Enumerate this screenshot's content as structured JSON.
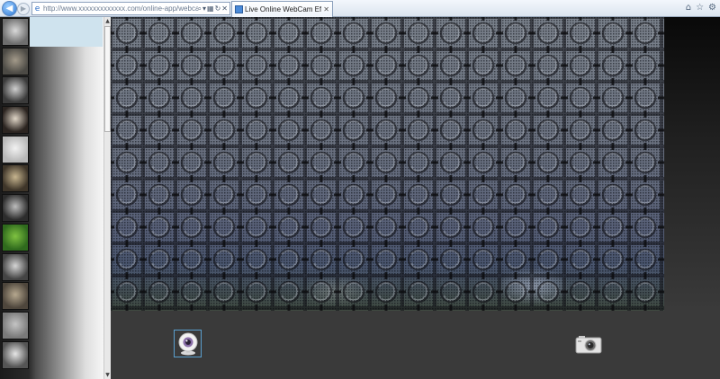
{
  "browser": {
    "url": "http://www.xxxxxxxxxxxxx.com/online-app/webcam-ef",
    "tab_title": "Live Online WebCam Eff...",
    "icons": [
      "back-icon",
      "forward-icon",
      "search-icon",
      "refresh-icon",
      "stop-icon",
      "home-icon",
      "favorites-icon",
      "tools-icon"
    ]
  },
  "sidebar": {
    "thumbnails": [
      {
        "name": "koala",
        "colors": [
          "#d9d9d9",
          "#6e6e6e"
        ]
      },
      {
        "name": "koala-texture",
        "colors": [
          "#a39a8a",
          "#4c4a45"
        ]
      },
      {
        "name": "spiral",
        "colors": [
          "#cfcfcf",
          "#3b3b3b"
        ]
      },
      {
        "name": "stripes",
        "colors": [
          "#e0d6c7",
          "#2b2420"
        ]
      },
      {
        "name": "white-blur",
        "colors": [
          "#f2f2f2",
          "#b8b8b8"
        ]
      },
      {
        "name": "koala-color",
        "colors": [
          "#c7b58f",
          "#3e3529"
        ]
      },
      {
        "name": "koala-dark",
        "colors": [
          "#bdbdbd",
          "#2c2c2c"
        ]
      },
      {
        "name": "green",
        "colors": [
          "#7fc241",
          "#2f6a1d"
        ]
      },
      {
        "name": "koala-mono",
        "colors": [
          "#d5d5d5",
          "#444444"
        ]
      },
      {
        "name": "koala-blur",
        "colors": [
          "#b6a88f",
          "#4e463c"
        ]
      },
      {
        "name": "emboss",
        "colors": [
          "#c4c4c4",
          "#7a7a7a"
        ]
      },
      {
        "name": "koala-sketch",
        "colors": [
          "#e6e6e6",
          "#555555"
        ]
      }
    ]
  },
  "colors": {
    "highlight": "#cfe3ee",
    "accent": "#5aa0cf"
  },
  "controls": {
    "webcam_icon": "webcam-icon",
    "snapshot_icon": "camera-icon"
  }
}
